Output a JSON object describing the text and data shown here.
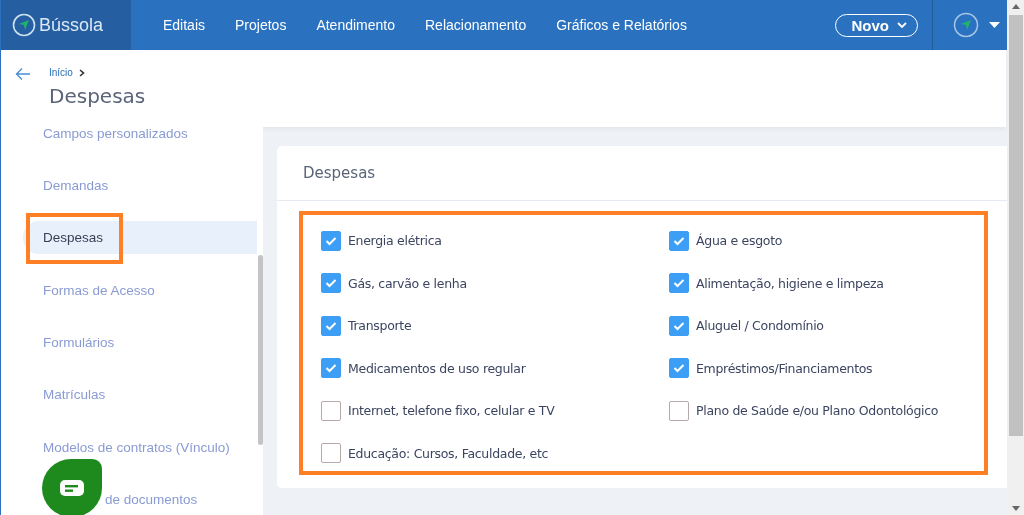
{
  "header": {
    "logo": "Bússola",
    "nav": [
      "Editais",
      "Projetos",
      "Atendimento",
      "Relacionamento",
      "Gráficos e Relatórios"
    ],
    "new_button": "Novo"
  },
  "breadcrumb": {
    "items": [
      "Início"
    ],
    "title": "Despesas"
  },
  "sidebar": {
    "items": [
      {
        "label": "Campos personalizados",
        "selected": false
      },
      {
        "label": "Demandas",
        "selected": false
      },
      {
        "label": "Despesas",
        "selected": true
      },
      {
        "label": "Formas de Acesso",
        "selected": false
      },
      {
        "label": "Formulários",
        "selected": false
      },
      {
        "label": "Matrículas",
        "selected": false
      },
      {
        "label": "Modelos de contratos (Vínculo)",
        "selected": false
      },
      {
        "label": "de documentos",
        "selected": false
      }
    ]
  },
  "card": {
    "title": "Despesas",
    "options": [
      {
        "label": "Energia elétrica",
        "checked": true
      },
      {
        "label": "Água e esgoto",
        "checked": true
      },
      {
        "label": "Gás, carvão e lenha",
        "checked": true
      },
      {
        "label": "Alimentação, higiene e limpeza",
        "checked": true
      },
      {
        "label": "Transporte",
        "checked": true
      },
      {
        "label": "Aluguel / Condomínio",
        "checked": true
      },
      {
        "label": "Medicamentos de uso regular",
        "checked": true
      },
      {
        "label": "Empréstimos/Financiamentos",
        "checked": true
      },
      {
        "label": "Internet, telefone fixo, celular e TV",
        "checked": false
      },
      {
        "label": "Plano de Saúde e/ou Plano Odontológico",
        "checked": false
      },
      {
        "label": "Educação: Cursos, Faculdade, etc",
        "checked": false
      }
    ]
  }
}
